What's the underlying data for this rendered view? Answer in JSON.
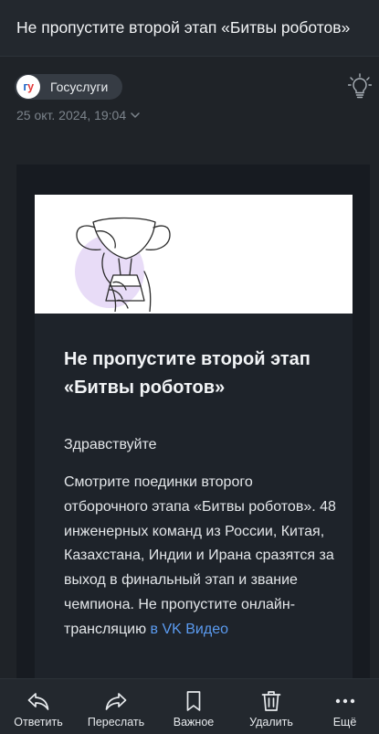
{
  "header": {
    "title": "Не пропустите второй этап «Битвы роботов»"
  },
  "sender": {
    "avatar_text_1": "г",
    "avatar_text_2": "у",
    "name": "Госуслуги",
    "date": "25 окт. 2024, 19:04"
  },
  "icons": {
    "bulb": "lightbulb-icon",
    "chevron": "chevron-down-icon",
    "trophy": "trophy-illustration"
  },
  "email": {
    "title": "Не пропустите второй этап «Битвы роботов»",
    "greeting": "Здравствуйте",
    "body": "Смотрите поединки второго отборочного этапа «Битвы роботов». 48 инженерных команд из России, Китая, Казахстана, Индии и Ирана сразятся за выход в финальный этап и звание чемпиона. Не пропустите онлайн-трансляцию ",
    "link": "в VK Видео"
  },
  "toolbar": {
    "reply": "Ответить",
    "forward": "Переслать",
    "important": "Важное",
    "delete": "Удалить",
    "more": "Ещё"
  },
  "colors": {
    "background": "#1f2328",
    "link": "#5b9bf0",
    "banner": "#ffffff"
  }
}
